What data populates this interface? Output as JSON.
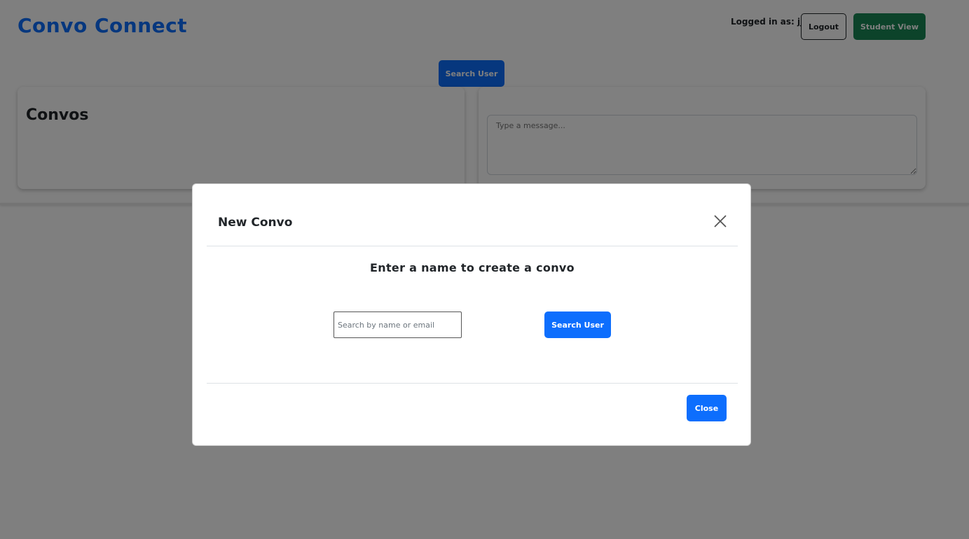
{
  "header": {
    "app_title": "Convo Connect",
    "logged_in_text": "Logged in as: jj",
    "logout_label": "Logout",
    "student_view_label": "Student View"
  },
  "toolbar": {
    "search_user_label": "Search User"
  },
  "convos_panel": {
    "title": "Convos"
  },
  "message_panel": {
    "placeholder": "Type a message..."
  },
  "modal": {
    "title": "New Convo",
    "heading": "Enter a name to create a convo",
    "search_placeholder": "Search by name or email",
    "search_button_label": "Search User",
    "close_button_label": "Close",
    "close_icon": "close-icon"
  },
  "colors": {
    "primary": "#0d6efd",
    "success": "#198754",
    "backdrop": "rgba(0,0,0,0.5)"
  }
}
